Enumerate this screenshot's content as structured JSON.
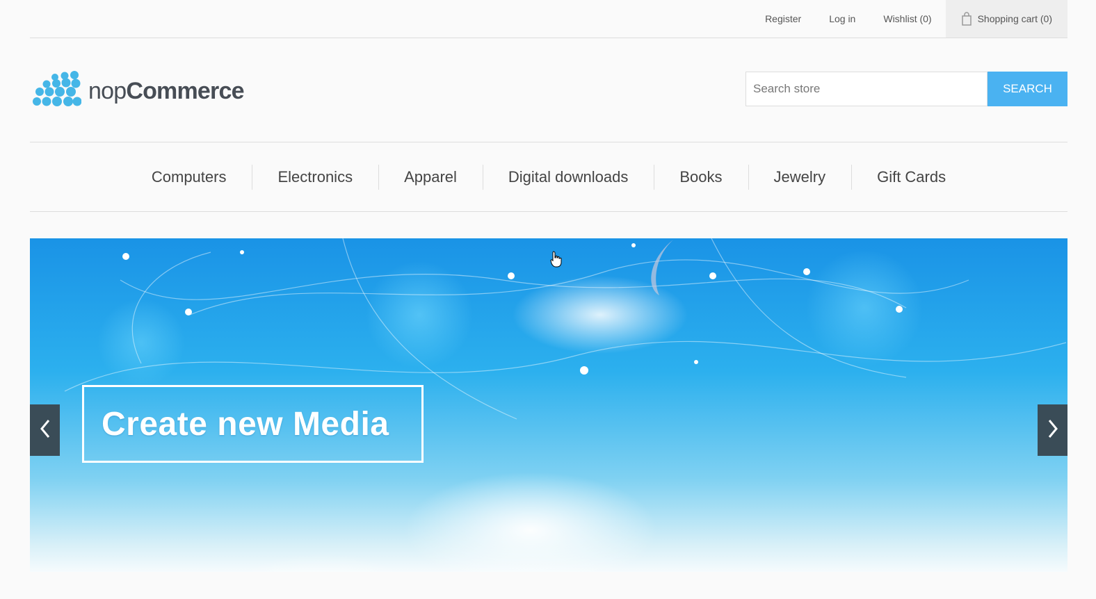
{
  "header": {
    "links": {
      "register": "Register",
      "login": "Log in",
      "wishlist": "Wishlist (0)",
      "cart": "Shopping cart (0)"
    }
  },
  "logo": {
    "text_light": "nop",
    "text_bold": "Commerce",
    "dot_color": "#45b6e7"
  },
  "search": {
    "placeholder": "Search store",
    "button_label": "SEARCH",
    "button_color": "#4ab2f1"
  },
  "menu": {
    "items": [
      "Computers",
      "Electronics",
      "Apparel",
      "Digital downloads",
      "Books",
      "Jewelry",
      "Gift Cards"
    ]
  },
  "slider": {
    "caption": "Create new Media",
    "prev_icon": "chevron-left-icon",
    "next_icon": "chevron-right-icon"
  }
}
